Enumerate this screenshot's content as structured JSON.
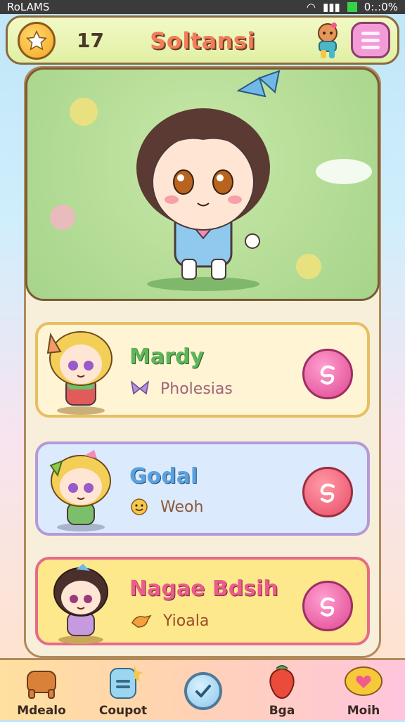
{
  "status_bar": {
    "left": "RoLAMS",
    "time": "0:.:0%"
  },
  "header": {
    "count": "17",
    "title": "Soltansi"
  },
  "characters": [
    {
      "name": "Mardy",
      "tag": "Pholesias"
    },
    {
      "name": "Godal",
      "tag": "Weoh"
    },
    {
      "name": "Nagae Bdsih",
      "tag": "Yioala"
    }
  ],
  "nav": [
    {
      "label": "Mdealo"
    },
    {
      "label": "Coupot"
    },
    {
      "label": "Bga"
    },
    {
      "label": "Moih"
    }
  ],
  "colors": {
    "accent": "#f07e5a",
    "card1": "#fff4d3",
    "card2": "#dbeafd",
    "card3": "#fde98b"
  }
}
